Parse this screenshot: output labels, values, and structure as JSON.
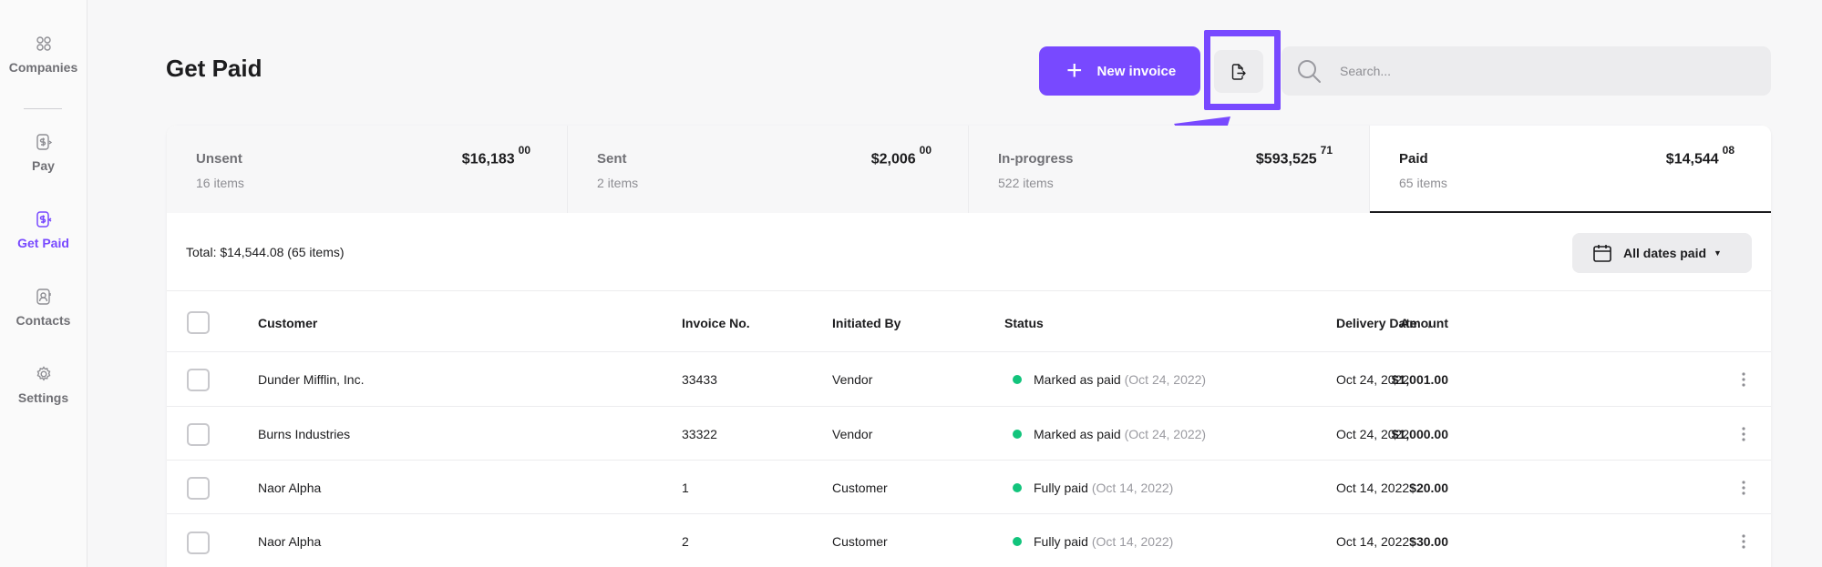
{
  "sidebar": {
    "items": [
      {
        "label": "Companies",
        "icon": "grid-icon"
      },
      {
        "label": "Pay",
        "icon": "pay-icon"
      },
      {
        "label": "Get Paid",
        "icon": "get-paid-icon",
        "active": true
      },
      {
        "label": "Contacts",
        "icon": "contact-icon"
      },
      {
        "label": "Settings",
        "icon": "gear-icon"
      }
    ]
  },
  "header": {
    "title": "Get Paid",
    "new_invoice_label": "New invoice",
    "search_placeholder": "Search..."
  },
  "tabs": [
    {
      "label": "Unsent",
      "count": "16 items",
      "amount": "$16,183",
      "cents": "00"
    },
    {
      "label": "Sent",
      "count": "2 items",
      "amount": "$2,006",
      "cents": "00"
    },
    {
      "label": "In-progress",
      "count": "522 items",
      "amount": "$593,525",
      "cents": "71"
    },
    {
      "label": "Paid",
      "count": "65 items",
      "amount": "$14,544",
      "cents": "08",
      "active": true
    }
  ],
  "summary": {
    "total_text": "Total: $14,544.08 (65 items)",
    "date_filter_label": "All dates paid"
  },
  "table": {
    "columns": {
      "customer": "Customer",
      "invoice_no": "Invoice No.",
      "initiated_by": "Initiated By",
      "status": "Status",
      "delivery_date": "Delivery Date",
      "amount": "Amount"
    },
    "rows": [
      {
        "customer": "Dunder Mifflin, Inc.",
        "invoice_no": "33433",
        "initiated_by": "Vendor",
        "status": "Marked as paid",
        "status_date": "(Oct 24, 2022)",
        "delivery_date": "Oct 24, 2022",
        "amount": "$1,001.00"
      },
      {
        "customer": "Burns Industries",
        "invoice_no": "33322",
        "initiated_by": "Vendor",
        "status": "Marked as paid",
        "status_date": "(Oct 24, 2022)",
        "delivery_date": "Oct 24, 2022",
        "amount": "$1,000.00"
      },
      {
        "customer": "Naor Alpha",
        "invoice_no": "1",
        "initiated_by": "Customer",
        "status": "Fully paid",
        "status_date": "(Oct 14, 2022)",
        "delivery_date": "Oct 14, 2022",
        "amount": "$20.00"
      },
      {
        "customer": "Naor Alpha",
        "invoice_no": "2",
        "initiated_by": "Customer",
        "status": "Fully paid",
        "status_date": "(Oct 14, 2022)",
        "delivery_date": "Oct 14, 2022",
        "amount": "$30.00"
      }
    ]
  },
  "colors": {
    "accent": "#7849ff",
    "status_paid": "#12c47c"
  }
}
